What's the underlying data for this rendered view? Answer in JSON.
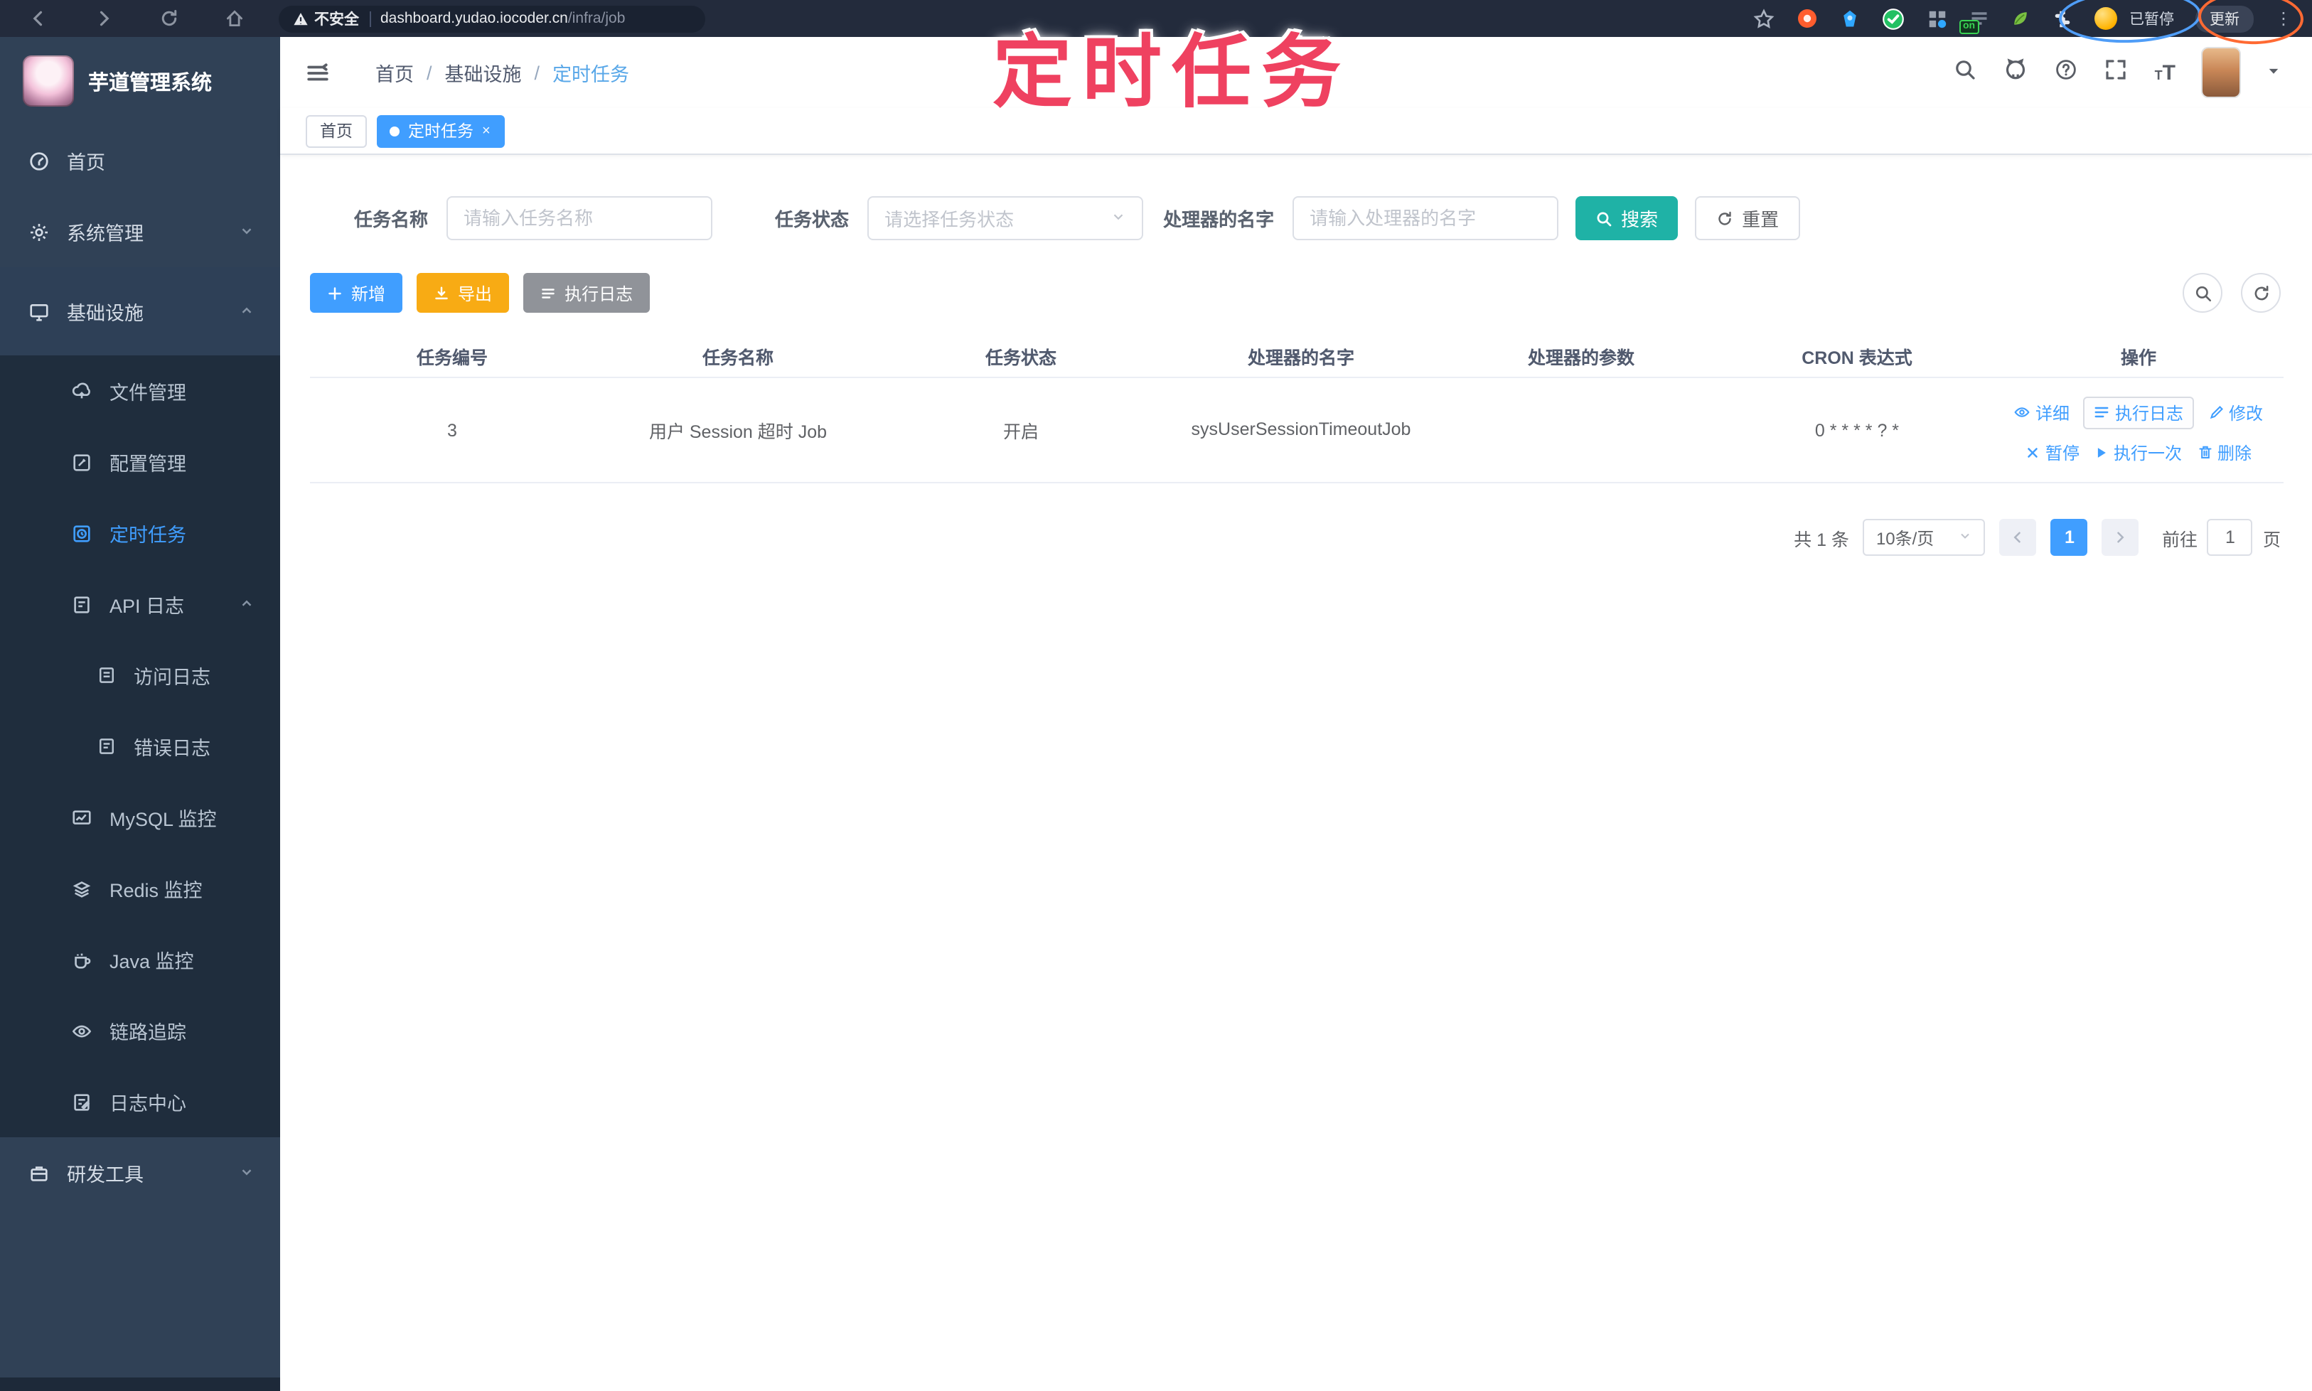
{
  "browser": {
    "security_warning": "不安全",
    "url_host": "dashboard.yudao.iocoder.cn",
    "url_path": "/infra/job",
    "on_badge": "on",
    "paused_badge": "已暂停",
    "update_button": "更新"
  },
  "annotation": {
    "title": "定时任务"
  },
  "sidebar": {
    "app_title": "芋道管理系统",
    "items": [
      {
        "label": "首页"
      },
      {
        "label": "系统管理"
      },
      {
        "label": "基础设施"
      },
      {
        "label": "文件管理"
      },
      {
        "label": "配置管理"
      },
      {
        "label": "定时任务"
      },
      {
        "label": "API 日志"
      },
      {
        "label": "访问日志"
      },
      {
        "label": "错误日志"
      },
      {
        "label": "MySQL 监控"
      },
      {
        "label": "Redis 监控"
      },
      {
        "label": "Java 监控"
      },
      {
        "label": "链路追踪"
      },
      {
        "label": "日志中心"
      },
      {
        "label": "研发工具"
      }
    ]
  },
  "breadcrumb": {
    "0": "首页",
    "1": "基础设施",
    "2": "定时任务",
    "separator": "/"
  },
  "tabs": {
    "home": "首页",
    "current": "定时任务",
    "close": "×"
  },
  "filters": {
    "name_label": "任务名称",
    "name_placeholder": "请输入任务名称",
    "status_label": "任务状态",
    "status_placeholder": "请选择任务状态",
    "handler_label": "处理器的名字",
    "handler_placeholder": "请输入处理器的名字",
    "search_label": "搜索",
    "reset_label": "重置"
  },
  "toolbar": {
    "add_label": "新增",
    "export_label": "导出",
    "exec_log_label": "执行日志"
  },
  "table": {
    "headers": [
      "任务编号",
      "任务名称",
      "任务状态",
      "处理器的名字",
      "处理器的参数",
      "CRON 表达式",
      "操作"
    ],
    "row": {
      "id": "3",
      "name": "用户 Session 超时 Job",
      "status": "开启",
      "handler": "sysUserSessionTimeoutJob",
      "param": "",
      "cron": "0 * * * * ? *"
    },
    "actions": [
      "详细",
      "执行日志",
      "修改",
      "暂停",
      "执行一次",
      "删除"
    ]
  },
  "pagination": {
    "total": "共 1 条",
    "page_size": "10条/页",
    "page": "1",
    "jump_label": "前往",
    "jump_value": "1",
    "jump_suffix": "页"
  },
  "colors": {
    "primary": "#409eff",
    "search_button": "#1fb2a6",
    "export_button": "#f8ab14",
    "info_button": "#909399",
    "sidebar_bg": "#304156",
    "submenu_bg": "#1f2d3d",
    "annotation": "#ef4160"
  }
}
